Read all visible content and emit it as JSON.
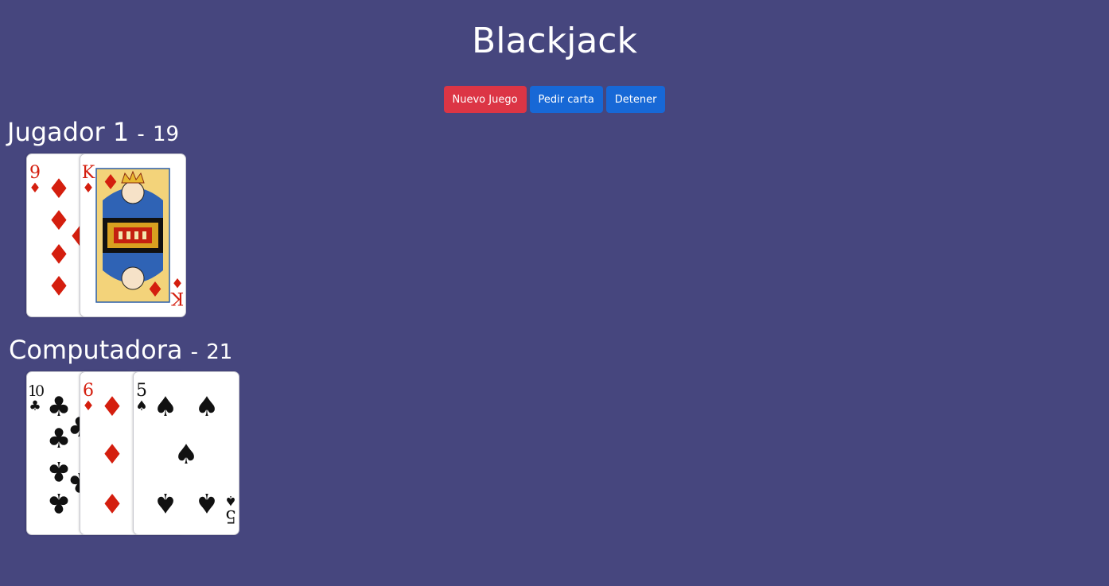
{
  "app": {
    "title": "Blackjack"
  },
  "toolbar": {
    "new_game_label": "Nuevo Juego",
    "hit_label": "Pedir carta",
    "stand_label": "Detener"
  },
  "players": [
    {
      "name": "Jugador 1",
      "separator": "-",
      "score": "19",
      "cards": [
        {
          "rank": "9",
          "suit": "diamonds"
        },
        {
          "rank": "K",
          "suit": "diamonds"
        }
      ]
    },
    {
      "name": "Computadora",
      "separator": "-",
      "score": "21",
      "cards": [
        {
          "rank": "10",
          "suit": "clubs"
        },
        {
          "rank": "6",
          "suit": "diamonds"
        },
        {
          "rank": "5",
          "suit": "spades"
        }
      ]
    }
  ],
  "colors": {
    "background": "#46467e",
    "new_game_button": "#dc3545",
    "action_button": "#1768d6",
    "red_suit": "#d41e0e",
    "black_suit": "#111111"
  }
}
